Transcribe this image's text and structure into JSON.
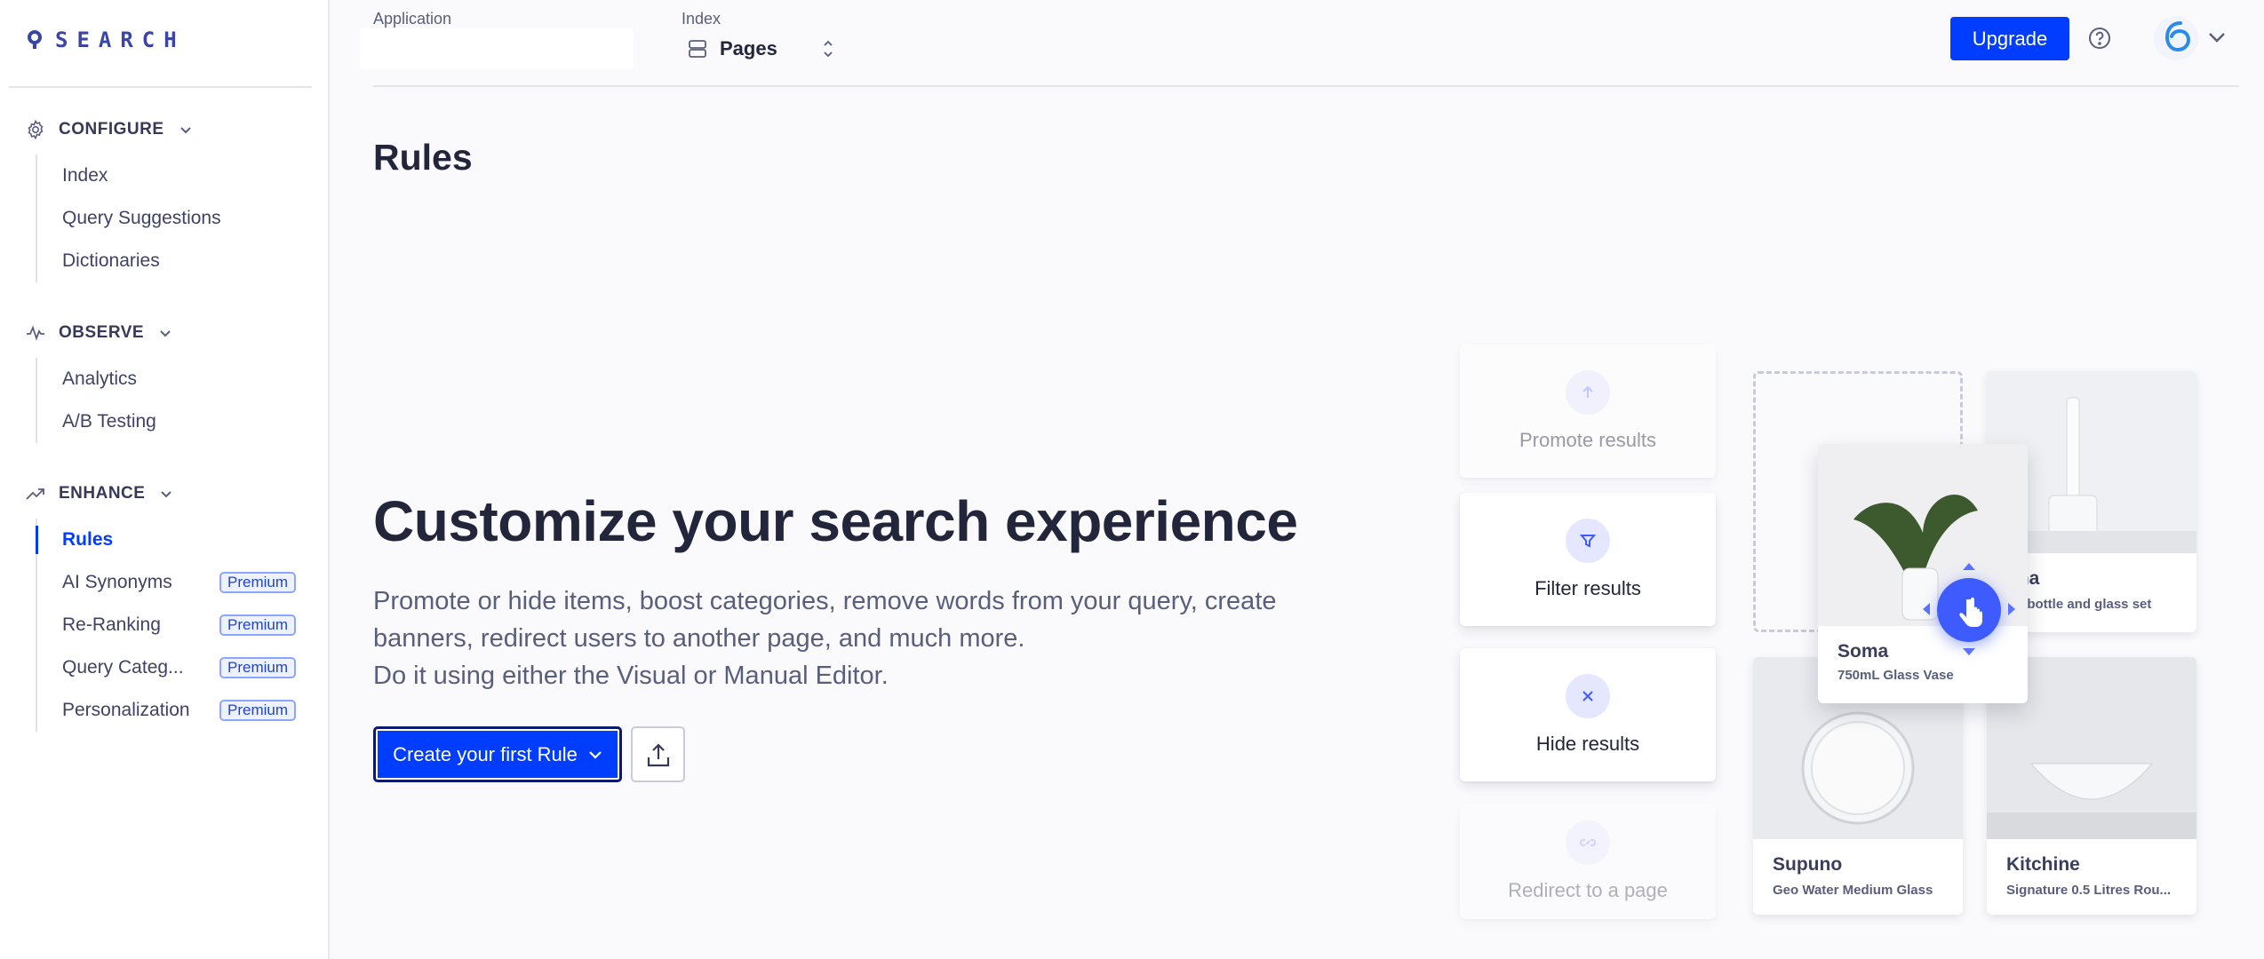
{
  "brand": {
    "name": "SEARCH"
  },
  "sidebar": {
    "sections": [
      {
        "label": "CONFIGURE",
        "icon": "gear-icon",
        "items": [
          {
            "label": "Index"
          },
          {
            "label": "Query Suggestions"
          },
          {
            "label": "Dictionaries"
          }
        ]
      },
      {
        "label": "OBSERVE",
        "icon": "pulse-icon",
        "items": [
          {
            "label": "Analytics"
          },
          {
            "label": "A/B Testing"
          }
        ]
      },
      {
        "label": "ENHANCE",
        "icon": "trend-icon",
        "items": [
          {
            "label": "Rules",
            "active": true
          },
          {
            "label": "AI Synonyms",
            "badge": "Premium"
          },
          {
            "label": "Re-Ranking",
            "badge": "Premium"
          },
          {
            "label": "Query Categ...",
            "badge": "Premium"
          },
          {
            "label": "Personalization",
            "badge": "Premium"
          }
        ]
      }
    ]
  },
  "topbar": {
    "application_label": "Application",
    "application_value": "",
    "index_label": "Index",
    "index_value": "Pages",
    "upgrade_label": "Upgrade"
  },
  "main": {
    "page_title": "Rules",
    "hero_title": "Customize your search experience",
    "hero_lines": [
      "Promote or hide items, boost categories, remove words from your query, create",
      "banners, redirect users to another page, and much more.",
      "Do it using either the Visual or Manual Editor."
    ],
    "create_button_label": "Create your first Rule"
  },
  "illustration": {
    "rule_cards": [
      {
        "label": "Promote results",
        "icon": "arrow-up-icon"
      },
      {
        "label": "Filter results",
        "icon": "filter-icon"
      },
      {
        "label": "Hide results",
        "icon": "close-icon"
      },
      {
        "label": "Redirect to a page",
        "icon": "link-icon"
      }
    ],
    "products": [
      {
        "name": "ona",
        "sub": "ter bottle and glass set"
      },
      {
        "name": "Supuno",
        "sub": "Geo Water Medium Glass"
      },
      {
        "name": "Kitchine",
        "sub": "Signature 0.5 Litres Rou..."
      }
    ],
    "dragged_product": {
      "name": "Soma",
      "sub": "750mL Glass Vase"
    }
  },
  "colors": {
    "accent": "#003dff",
    "text": "#23263b",
    "muted": "#5a5e7d",
    "brand": "#3a46a4"
  }
}
